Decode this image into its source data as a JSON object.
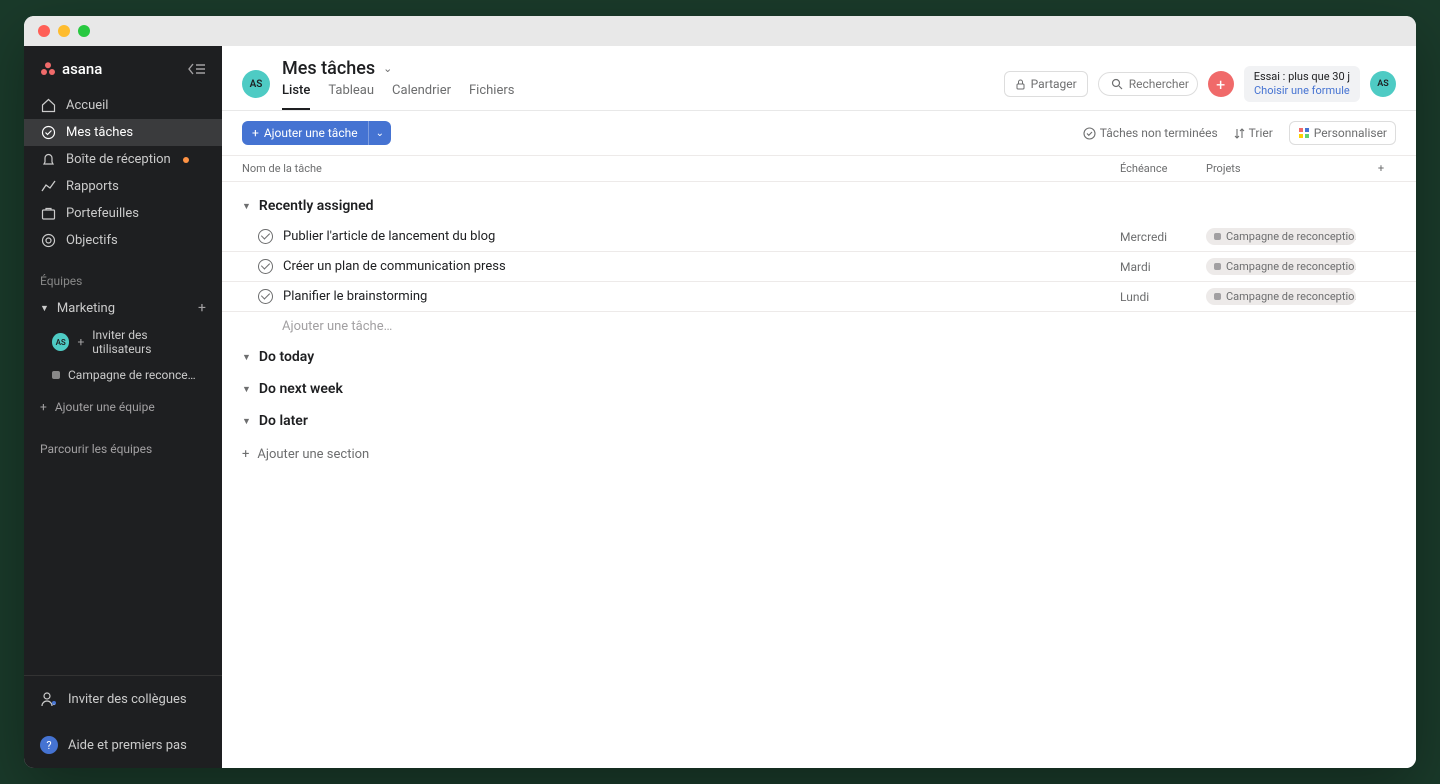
{
  "brand": "asana",
  "user_initials": "AS",
  "sidebar": {
    "nav": [
      {
        "label": "Accueil",
        "icon": "home"
      },
      {
        "label": "Mes tâches",
        "icon": "check",
        "active": true
      },
      {
        "label": "Boîte de réception",
        "icon": "bell",
        "notif": true
      },
      {
        "label": "Rapports",
        "icon": "chart"
      },
      {
        "label": "Portefeuilles",
        "icon": "folder"
      },
      {
        "label": "Objectifs",
        "icon": "target"
      }
    ],
    "teams_label": "Équipes",
    "team_name": "Marketing",
    "invite_label": "Inviter des utilisateurs",
    "project_label": "Campagne de reconce…",
    "add_team_label": "Ajouter une équipe",
    "browse_label": "Parcourir les équipes",
    "invite_colleagues": "Inviter des collègues",
    "help_label": "Aide et premiers pas"
  },
  "header": {
    "title": "Mes tâches",
    "tabs": [
      "Liste",
      "Tableau",
      "Calendrier",
      "Fichiers"
    ],
    "share_label": "Partager",
    "search_placeholder": "Rechercher",
    "trial_line1": "Essai : plus que 30 j",
    "trial_line2": "Choisir une formule"
  },
  "toolbar": {
    "add_task_label": "Ajouter une tâche",
    "incomplete_label": "Tâches non terminées",
    "sort_label": "Trier",
    "customize_label": "Personnaliser"
  },
  "columns": {
    "name": "Nom de la tâche",
    "due": "Échéance",
    "projects": "Projets"
  },
  "sections": {
    "recently": "Recently assigned",
    "today": "Do today",
    "next_week": "Do next week",
    "later": "Do later",
    "add_section": "Ajouter une section",
    "add_task_inline": "Ajouter une tâche…"
  },
  "tasks": [
    {
      "name": "Publier l'article de lancement du blog",
      "due": "Mercredi",
      "project": "Campagne de reconceptio…"
    },
    {
      "name": "Créer un plan de communication press",
      "due": "Mardi",
      "project": "Campagne de reconceptio…"
    },
    {
      "name": "Planifier le brainstorming",
      "due": "Lundi",
      "project": "Campagne de reconceptio…"
    }
  ]
}
